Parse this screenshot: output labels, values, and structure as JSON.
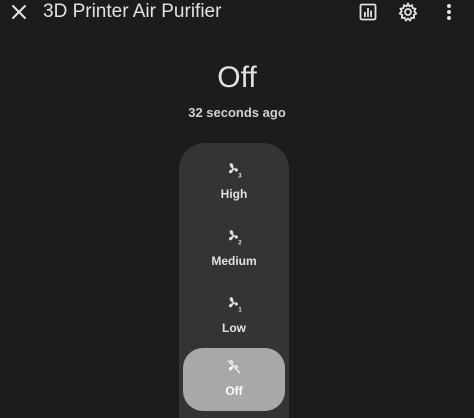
{
  "header": {
    "title": "3D Printer Air Purifier",
    "icons": [
      "close-icon",
      "history-chart-icon",
      "gear-icon",
      "more-vertical-icon"
    ]
  },
  "entity": {
    "state": "Off",
    "last_changed": "32 seconds ago"
  },
  "preset_modes": {
    "selected": "Off",
    "options": [
      {
        "label": "High",
        "icon": "fan-speed-3-icon"
      },
      {
        "label": "Medium",
        "icon": "fan-speed-2-icon"
      },
      {
        "label": "Low",
        "icon": "fan-speed-1-icon"
      },
      {
        "label": "Off",
        "icon": "fan-off-icon"
      }
    ]
  },
  "colors": {
    "background": "#1c1c1c",
    "control_track": "#343434",
    "active_option": "#a8a8a8",
    "text": "#e1e1e1"
  }
}
